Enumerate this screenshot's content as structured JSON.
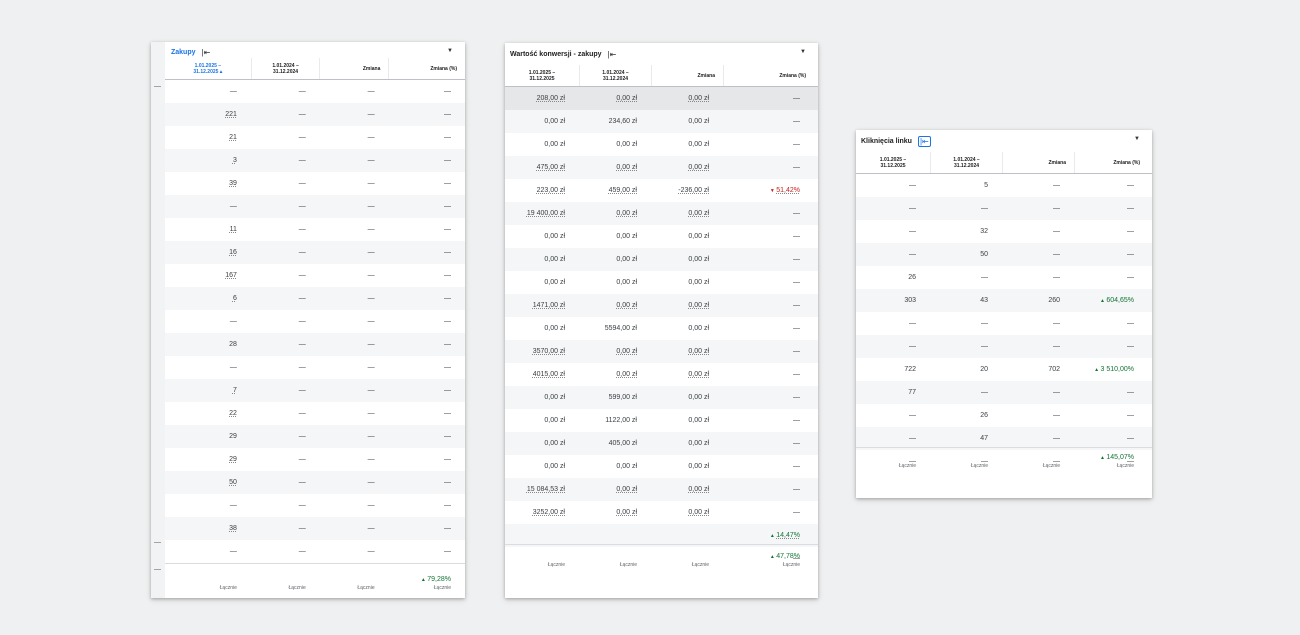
{
  "dash": "—",
  "total_label": "Łącznie",
  "colors": {
    "positive": "#137333",
    "negative": "#c5221f",
    "accent": "#1a73e8"
  },
  "icons": {
    "collapse": "collapse-left-icon",
    "dropdown": "dropdown-arrow-icon",
    "up": "triangle-up-icon",
    "down": "triangle-down-icon"
  },
  "tables": [
    {
      "title": "Zakupy",
      "columns": [
        {
          "label": "1.01.2025 –\n31.12.2025",
          "sort": "▴"
        },
        {
          "label": "1.01.2024 –\n31.12.2024"
        },
        {
          "label": "Zmiana"
        },
        {
          "label": "Zmiana (%)"
        }
      ],
      "rows": [
        [
          "—",
          "—",
          "—",
          "—"
        ],
        [
          "221",
          "—",
          "—",
          "—"
        ],
        [
          "21",
          "—",
          "—",
          "—"
        ],
        [
          "3",
          "—",
          "—",
          "—"
        ],
        [
          "39",
          "—",
          "—",
          "—"
        ],
        [
          "—",
          "—",
          "—",
          "—"
        ],
        [
          "11",
          "—",
          "—",
          "—"
        ],
        [
          "16",
          "—",
          "—",
          "—"
        ],
        [
          "167",
          "—",
          "—",
          "—"
        ],
        [
          "6",
          "—",
          "—",
          "—"
        ],
        [
          "—",
          "—",
          "—",
          "—"
        ],
        [
          "28",
          "—",
          "—",
          "—"
        ],
        [
          "—",
          "—",
          "—",
          "—"
        ],
        [
          "7",
          "—",
          "—",
          "—"
        ],
        [
          "22",
          "—",
          "—",
          "—"
        ],
        [
          "29",
          "—",
          "—",
          "—"
        ],
        [
          "29",
          "—",
          "—",
          "—"
        ],
        [
          "50",
          "—",
          "—",
          "—"
        ],
        [
          "—",
          "—",
          "—",
          "—"
        ],
        [
          "38",
          "—",
          "—",
          "—"
        ],
        [
          "—",
          "—",
          "—",
          "—"
        ]
      ],
      "footer": [
        "",
        "",
        "",
        "79,28%"
      ],
      "footer_dir": [
        "",
        "",
        "",
        "up"
      ]
    },
    {
      "title": "Wartość konwersji - zakupy",
      "columns": [
        {
          "label": "1.01.2025 –\n31.12.2025"
        },
        {
          "label": "1.01.2024 –\n31.12.2024"
        },
        {
          "label": "Zmiana"
        },
        {
          "label": "Zmiana (%)"
        }
      ],
      "rows": [
        [
          "208,00 zł",
          "0,00 zł",
          "0,00 zł",
          "—"
        ],
        [
          "0,00 zł",
          "234,60 zł",
          "0,00 zł",
          "—"
        ],
        [
          "0,00 zł",
          "0,00 zł",
          "0,00 zł",
          "—"
        ],
        [
          "475,00 zł",
          "0,00 zł",
          "0,00 zł",
          "—"
        ],
        [
          "223,00 zł",
          "459,00 zł",
          "-236,00 zł",
          "51,42%"
        ],
        [
          "19 400,00 zł",
          "0,00 zł",
          "0,00 zł",
          "—"
        ],
        [
          "0,00 zł",
          "0,00 zł",
          "0,00 zł",
          "—"
        ],
        [
          "0,00 zł",
          "0,00 zł",
          "0,00 zł",
          "—"
        ],
        [
          "0,00 zł",
          "0,00 zł",
          "0,00 zł",
          "—"
        ],
        [
          "1471,00 zł",
          "0,00 zł",
          "0,00 zł",
          "—"
        ],
        [
          "0,00 zł",
          "5594,00 zł",
          "0,00 zł",
          "—"
        ],
        [
          "3570,00 zł",
          "0,00 zł",
          "0,00 zł",
          "—"
        ],
        [
          "4015,00 zł",
          "0,00 zł",
          "0,00 zł",
          "—"
        ],
        [
          "0,00 zł",
          "599,00 zł",
          "0,00 zł",
          "—"
        ],
        [
          "0,00 zł",
          "1122,00 zł",
          "0,00 zł",
          "—"
        ],
        [
          "0,00 zł",
          "405,00 zł",
          "0,00 zł",
          "—"
        ],
        [
          "0,00 zł",
          "0,00 zł",
          "0,00 zł",
          "—"
        ],
        [
          "15 084,53 zł",
          "0,00 zł",
          "0,00 zł",
          "—"
        ],
        [
          "3252,00 zł",
          "0,00 zł",
          "0,00 zł",
          "—"
        ],
        [
          "",
          "",
          "",
          "14,47%"
        ],
        [
          "",
          "",
          "",
          "—"
        ]
      ],
      "footer": [
        "",
        "",
        "",
        "47,78%"
      ],
      "footer_dir": [
        "",
        "",
        "",
        "up"
      ]
    },
    {
      "title": "Kliknięcia linku",
      "columns": [
        {
          "label": "1.01.2025 –\n31.12.2025"
        },
        {
          "label": "1.01.2024 –\n31.12.2024"
        },
        {
          "label": "Zmiana"
        },
        {
          "label": "Zmiana (%)"
        }
      ],
      "rows": [
        [
          "—",
          "5",
          "—",
          "—"
        ],
        [
          "—",
          "—",
          "—",
          "—"
        ],
        [
          "—",
          "32",
          "—",
          "—"
        ],
        [
          "—",
          "50",
          "—",
          "—"
        ],
        [
          "26",
          "—",
          "—",
          "—"
        ],
        [
          "303",
          "43",
          "260",
          "604,65%"
        ],
        [
          "—",
          "—",
          "—",
          "—"
        ],
        [
          "—",
          "—",
          "—",
          "—"
        ],
        [
          "722",
          "20",
          "702",
          "3 510,00%"
        ],
        [
          "77",
          "—",
          "—",
          "—"
        ],
        [
          "—",
          "26",
          "—",
          "—"
        ],
        [
          "—",
          "47",
          "—",
          "—"
        ],
        [
          "—",
          "—",
          "—",
          "—"
        ]
      ],
      "footer": [
        "",
        "",
        "",
        "145,07%"
      ],
      "footer_dir": [
        "",
        "",
        "",
        "up"
      ]
    }
  ]
}
